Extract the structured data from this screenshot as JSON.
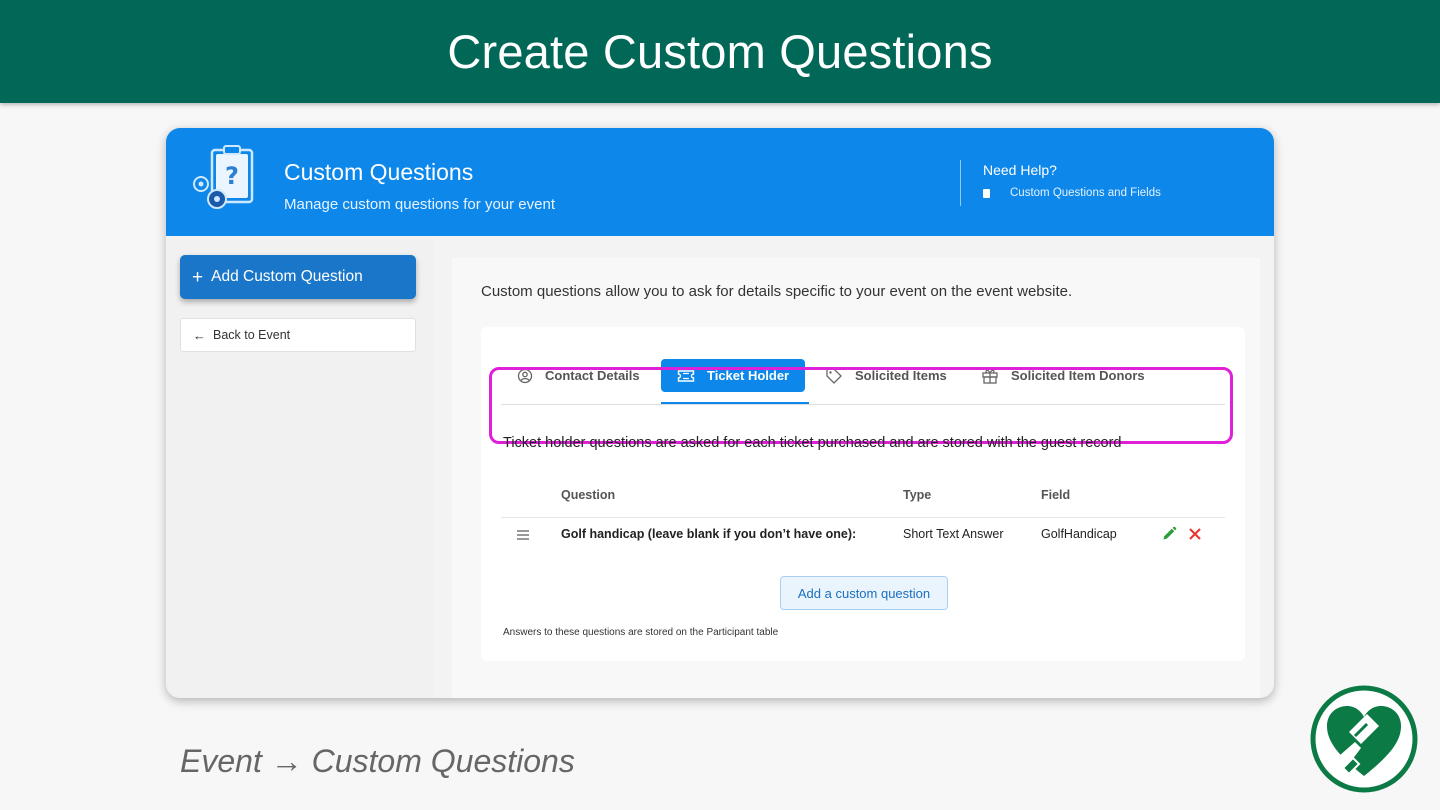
{
  "slide": {
    "title": "Create Custom Questions",
    "caption": "Event →  Custom Questions"
  },
  "header": {
    "title": "Custom Questions",
    "subtitle": "Manage custom questions for your event",
    "help_title": "Need Help?",
    "help_link": "Custom Questions and Fields"
  },
  "sidebar": {
    "add_button": "Add Custom Question",
    "back_button": "Back to Event"
  },
  "main": {
    "intro": "Custom questions allow you to ask for details specific to your event on the event website.",
    "tabs": [
      {
        "label": "Contact Details",
        "icon": "user-circle-icon"
      },
      {
        "label": "Ticket Holder",
        "icon": "ticket-icon",
        "active": true
      },
      {
        "label": "Solicited Items",
        "icon": "tag-icon"
      },
      {
        "label": "Solicited Item Donors",
        "icon": "gift-icon"
      }
    ],
    "description": "Ticket holder questions are asked for each ticket purchased and are stored with the guest record",
    "table": {
      "headers": [
        "Question",
        "Type",
        "Field"
      ],
      "rows": [
        {
          "question": "Golf handicap (leave blank if you don’t have one):",
          "type": "Short Text Answer",
          "field": "GolfHandicap"
        }
      ]
    },
    "add_question_button": "Add a custom question",
    "footnote": "Answers to these questions are stored on the Participant table"
  },
  "colors": {
    "banner": "#016858",
    "header_blue": "#0d88ea",
    "primary_button": "#1976c8",
    "highlight": "#e020d8",
    "edit": "#2e9e3a",
    "delete": "#e53935"
  }
}
